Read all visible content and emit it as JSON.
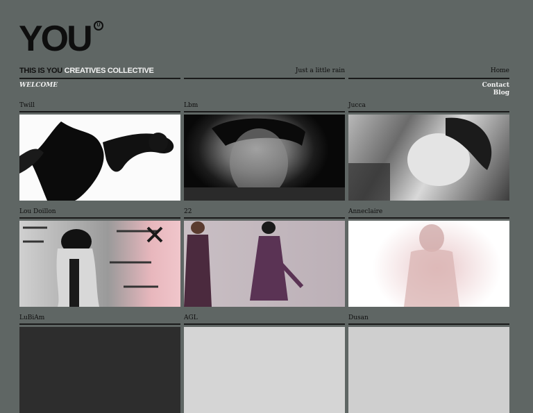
{
  "brand": {
    "logo_text": "YOU",
    "logo_badge": "U"
  },
  "header": {
    "tagline_dark": "THIS IS YOU",
    "tagline_light": "CREATIVES COLLECTIVE",
    "mid_link": "Just a little rain",
    "home_link": "Home"
  },
  "sub": {
    "welcome": "WELCOME",
    "contact": "Contact",
    "blog": "Blog"
  },
  "grid": [
    {
      "label": "Twill"
    },
    {
      "label": "Lbm"
    },
    {
      "label": "Jucca"
    },
    {
      "label": "Lou Doillon"
    },
    {
      "label": "22"
    },
    {
      "label": "Anneclaire"
    },
    {
      "label": "LuBiAm"
    },
    {
      "label": "AGL"
    },
    {
      "label": "Dusan"
    }
  ],
  "colors": {
    "background": "#5f6664",
    "rule": "#1a1a1a",
    "accent_text": "#f2f2f2"
  }
}
